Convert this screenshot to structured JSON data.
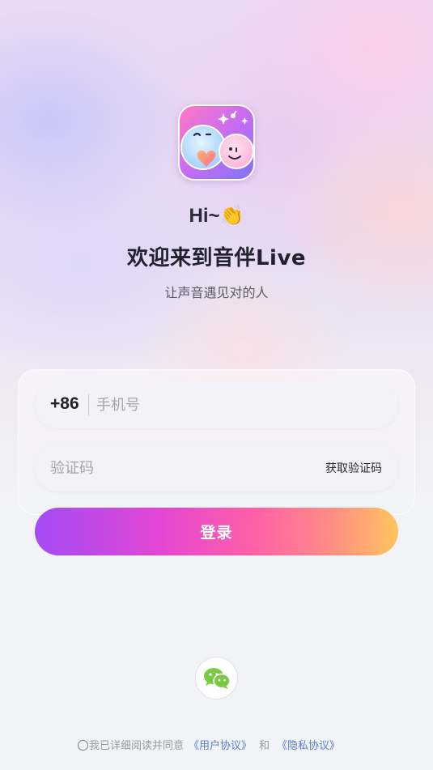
{
  "app": {
    "greeting": "Hi~👏",
    "welcome": "欢迎来到音伴Live",
    "tagline": "让声音遇见对的人"
  },
  "phone_field": {
    "country_code": "+86",
    "placeholder": "手机号",
    "value": ""
  },
  "code_field": {
    "placeholder": "验证码",
    "value": "",
    "get_code_label": "获取验证码"
  },
  "login_button": {
    "label": "登录"
  },
  "social_login": {
    "icon": "wechat-icon"
  },
  "agreement": {
    "prefix": "我已详细阅读并同意",
    "user_agreement": "《用户协议》",
    "and": "和",
    "privacy_policy": "《隐私协议》",
    "checked": false
  },
  "colors": {
    "gradient_start": "#a44bf6",
    "gradient_mid": "#ff5fa6",
    "gradient_end": "#ffc45c",
    "link": "#5b7bd8",
    "wechat": "#7ac843"
  }
}
